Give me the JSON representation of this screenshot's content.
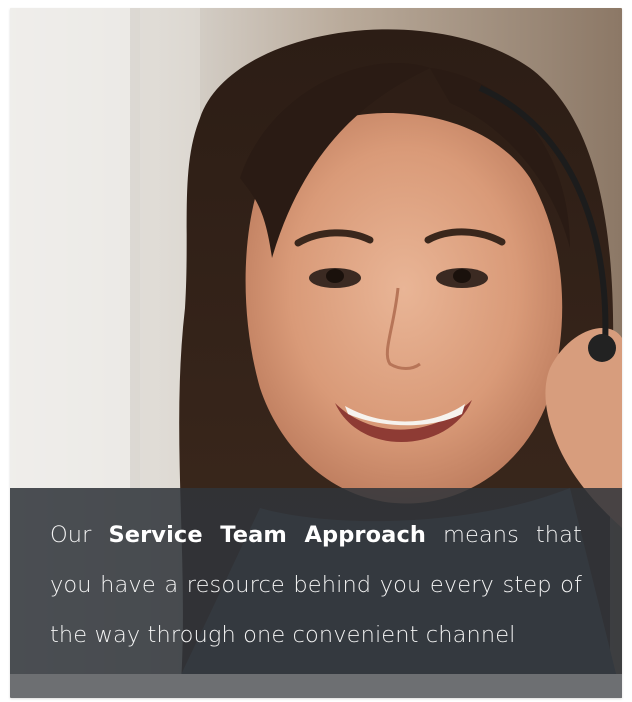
{
  "caption": {
    "lead": "Our ",
    "highlight": "Service Team Approach",
    "rest": " means that you have a resource behind you every step of the way through one convenient channel"
  },
  "colors": {
    "overlay": "#30343a",
    "text": "#f3f3f3",
    "bottom_bar": "#6d6f72"
  }
}
